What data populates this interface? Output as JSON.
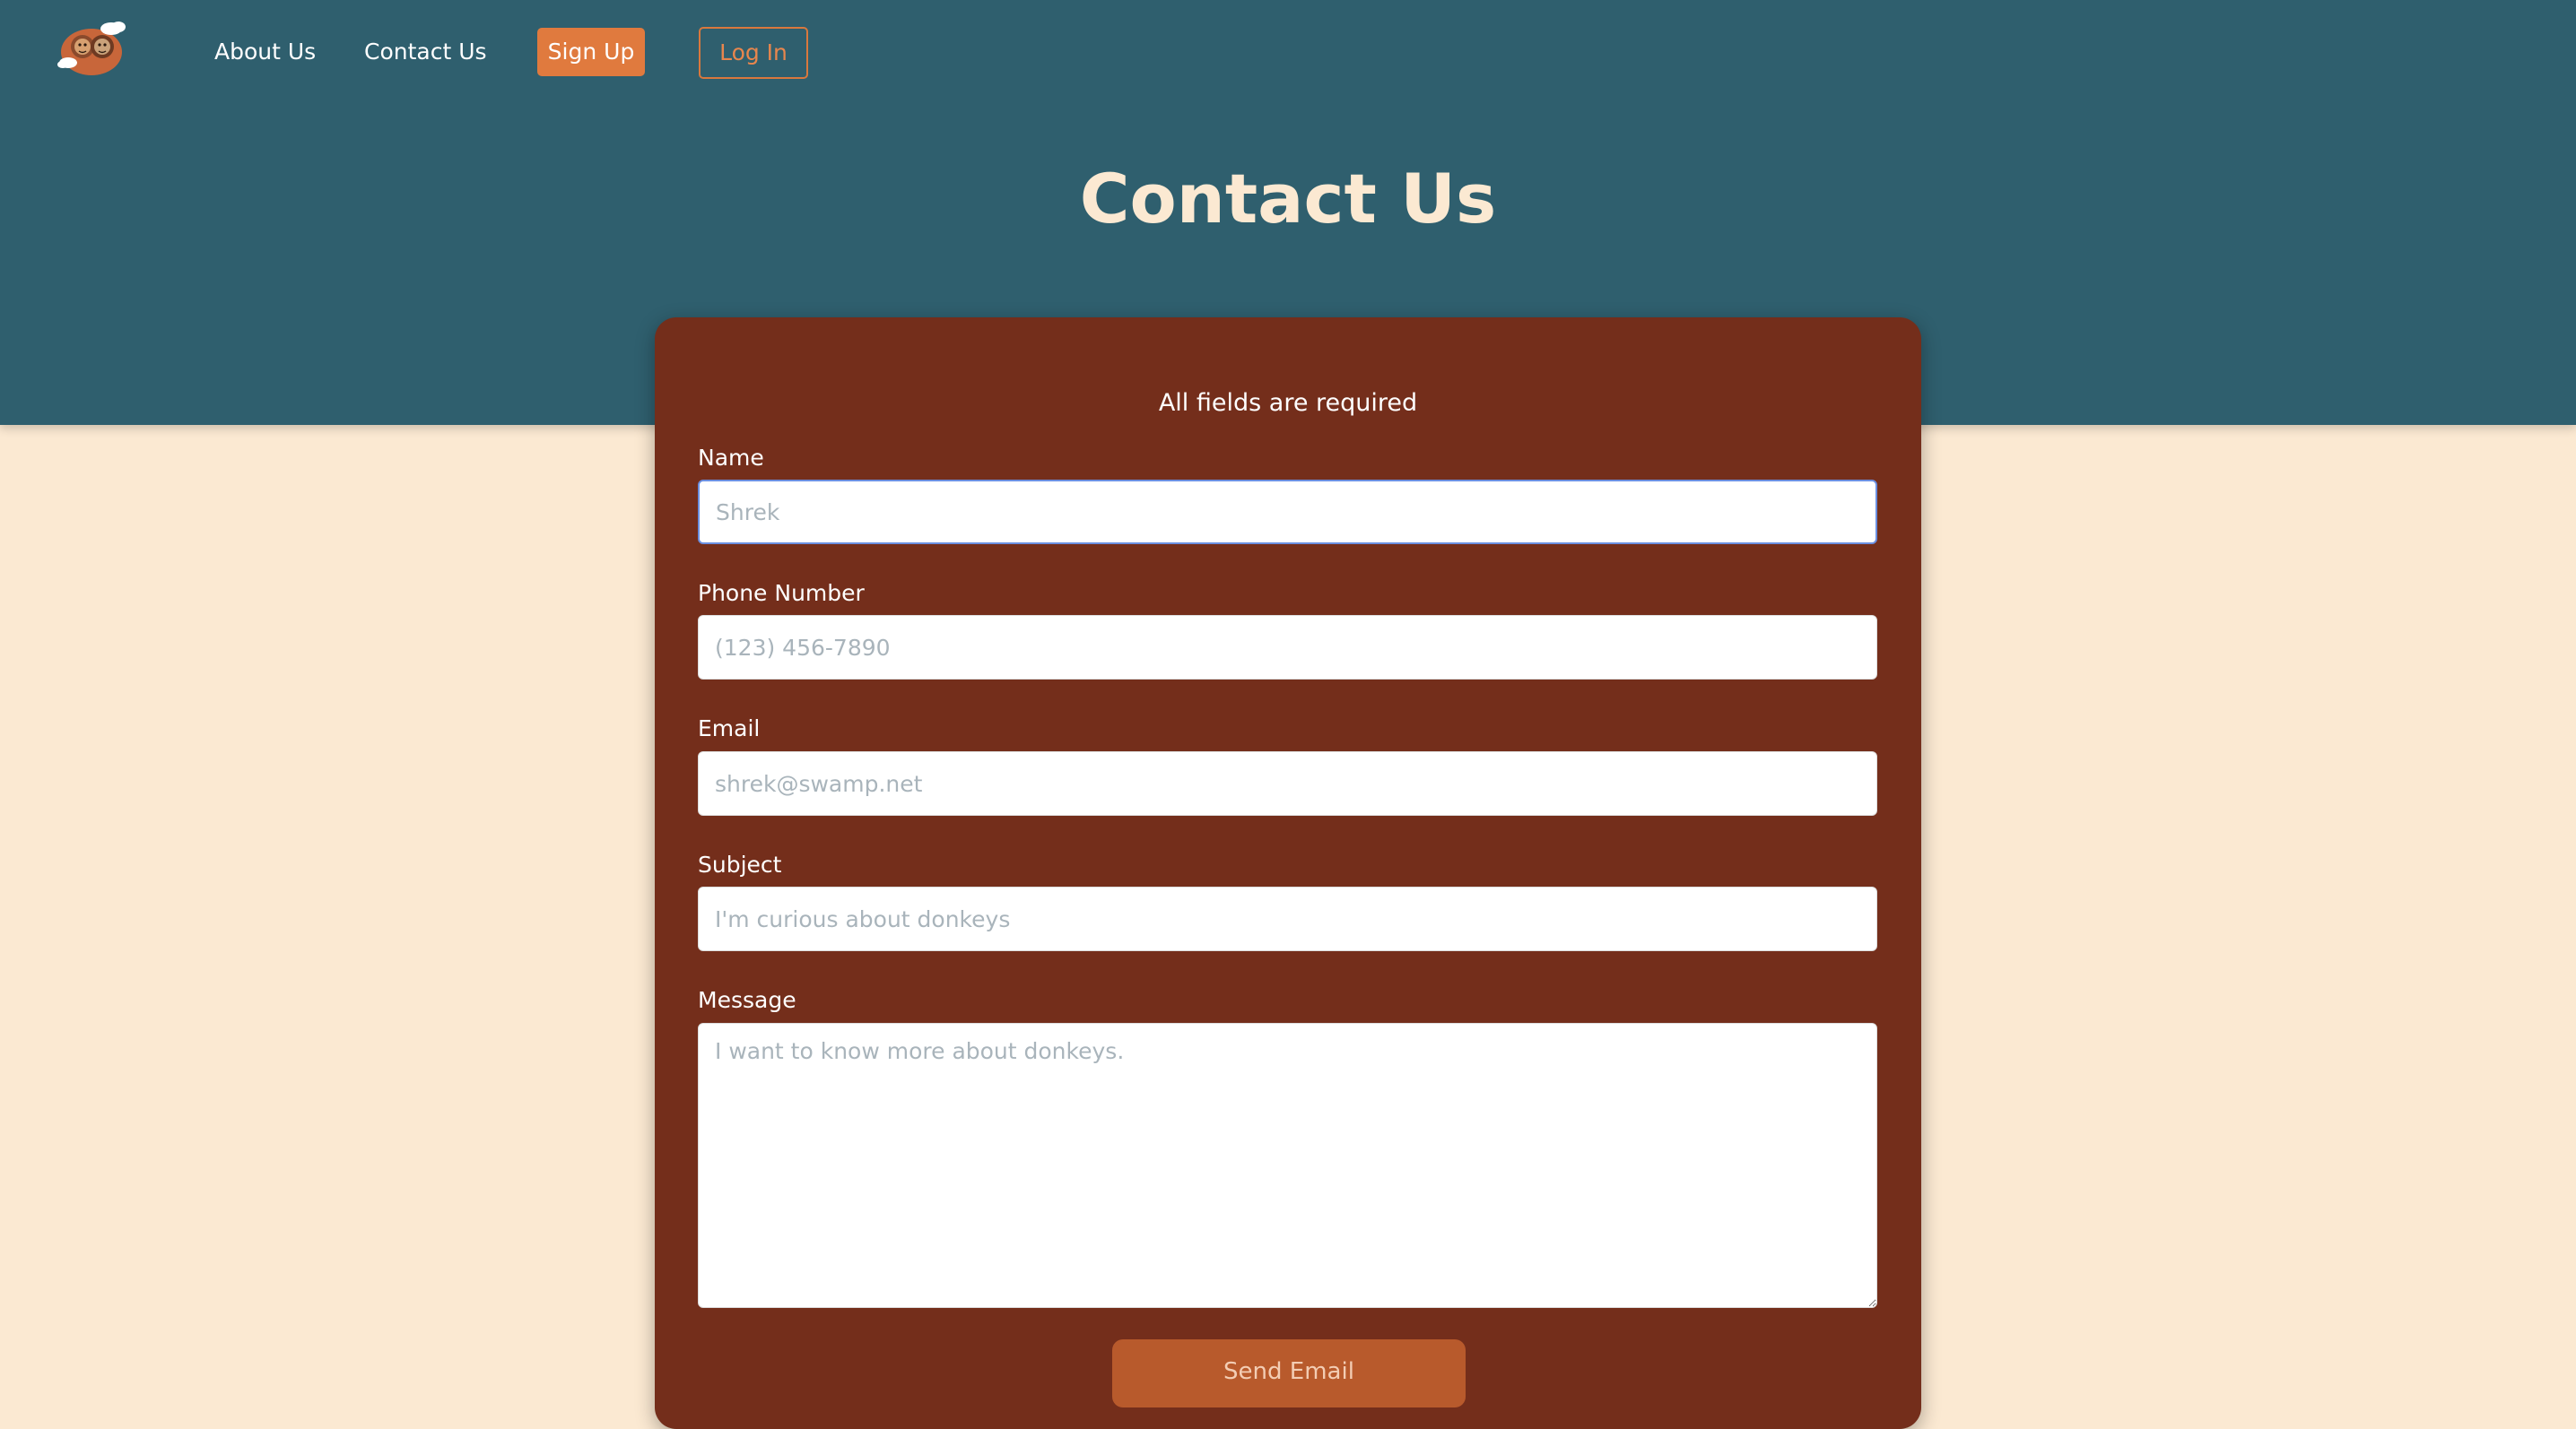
{
  "nav": {
    "logo_name": "site-logo",
    "links": [
      {
        "label": "About Us"
      },
      {
        "label": "Contact Us"
      }
    ],
    "signup_label": "Sign Up",
    "login_label": "Log In"
  },
  "page": {
    "title": "Contact Us"
  },
  "form": {
    "required_note": "All fields are required",
    "fields": {
      "name": {
        "label": "Name",
        "placeholder": "Shrek",
        "value": ""
      },
      "phone": {
        "label": "Phone Number",
        "placeholder": "(123) 456-7890",
        "value": ""
      },
      "email": {
        "label": "Email",
        "placeholder": "shrek@swamp.net",
        "value": ""
      },
      "subject": {
        "label": "Subject",
        "placeholder": "I'm curious about donkeys",
        "value": ""
      },
      "message": {
        "label": "Message",
        "placeholder": "I want to know more about donkeys.",
        "value": ""
      }
    },
    "submit_label": "Send Email"
  },
  "colors": {
    "header_bg": "#2f5f6e",
    "page_bg": "#fbe9d2",
    "card_bg": "#742e1b",
    "accent_orange": "#e07a3e",
    "submit_bg": "#b85a2c",
    "focus_border": "#6b8fe0"
  }
}
